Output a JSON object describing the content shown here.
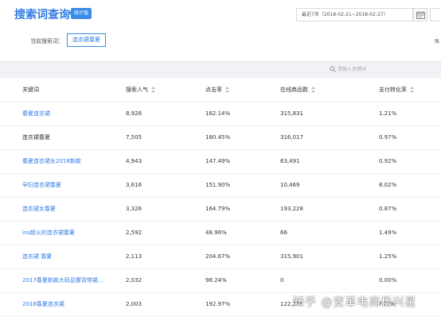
{
  "header": {
    "title": "搜索词查询",
    "badge": "统计值",
    "date_range": "最近7天（2018-02-21~2018-02-27）",
    "current_label": "当前搜索词：",
    "current_term": "连衣裙春夏",
    "edge_text": "账"
  },
  "search": {
    "placeholder": "请输入关键词"
  },
  "table": {
    "columns": [
      "关键词",
      "搜索人气",
      "点击率",
      "在线商品数",
      "支付转化率"
    ],
    "rows": [
      {
        "keyword": "春夏连衣裙",
        "popularity": "8,928",
        "ctr": "162.14%",
        "online": "315,831",
        "cvr": "1.21%",
        "link": true
      },
      {
        "keyword": "连衣裙春夏",
        "popularity": "7,505",
        "ctr": "180.45%",
        "online": "316,017",
        "cvr": "0.97%",
        "link": false
      },
      {
        "keyword": "春夏连衣裙女2018新款",
        "popularity": "4,943",
        "ctr": "147.49%",
        "online": "63,491",
        "cvr": "0.92%",
        "link": true
      },
      {
        "keyword": "孕妇连衣裙春夏",
        "popularity": "3,616",
        "ctr": "151.90%",
        "online": "10,469",
        "cvr": "8.02%",
        "link": true
      },
      {
        "keyword": "连衣裙女春夏",
        "popularity": "3,326",
        "ctr": "164.79%",
        "online": "193,228",
        "cvr": "0.87%",
        "link": true
      },
      {
        "keyword": "ins超火的连衣裙春夏",
        "popularity": "2,592",
        "ctr": "48.96%",
        "online": "66",
        "cvr": "1.49%",
        "link": true
      },
      {
        "keyword": "连衣裙 春夏",
        "popularity": "2,113",
        "ctr": "204.67%",
        "online": "315,901",
        "cvr": "1.25%",
        "link": true
      },
      {
        "keyword": "2017春夏新款大码显瘦背带裙单排扣...",
        "popularity": "2,032",
        "ctr": "98.24%",
        "online": "0",
        "cvr": "0.00%",
        "link": true
      },
      {
        "keyword": "2018春夏连衣裙",
        "popularity": "2,003",
        "ctr": "192.97%",
        "online": "122,2??",
        "cvr": "?.??%",
        "link": true
      }
    ]
  },
  "watermark": "知乎 @变革电商杨兴星",
  "colors": {
    "accent": "#2e7be6",
    "badge_bg": "#3b8ce9",
    "background": "#f0f2f5"
  },
  "icons": [
    "calendar-icon",
    "search-icon",
    "sort-icon"
  ]
}
